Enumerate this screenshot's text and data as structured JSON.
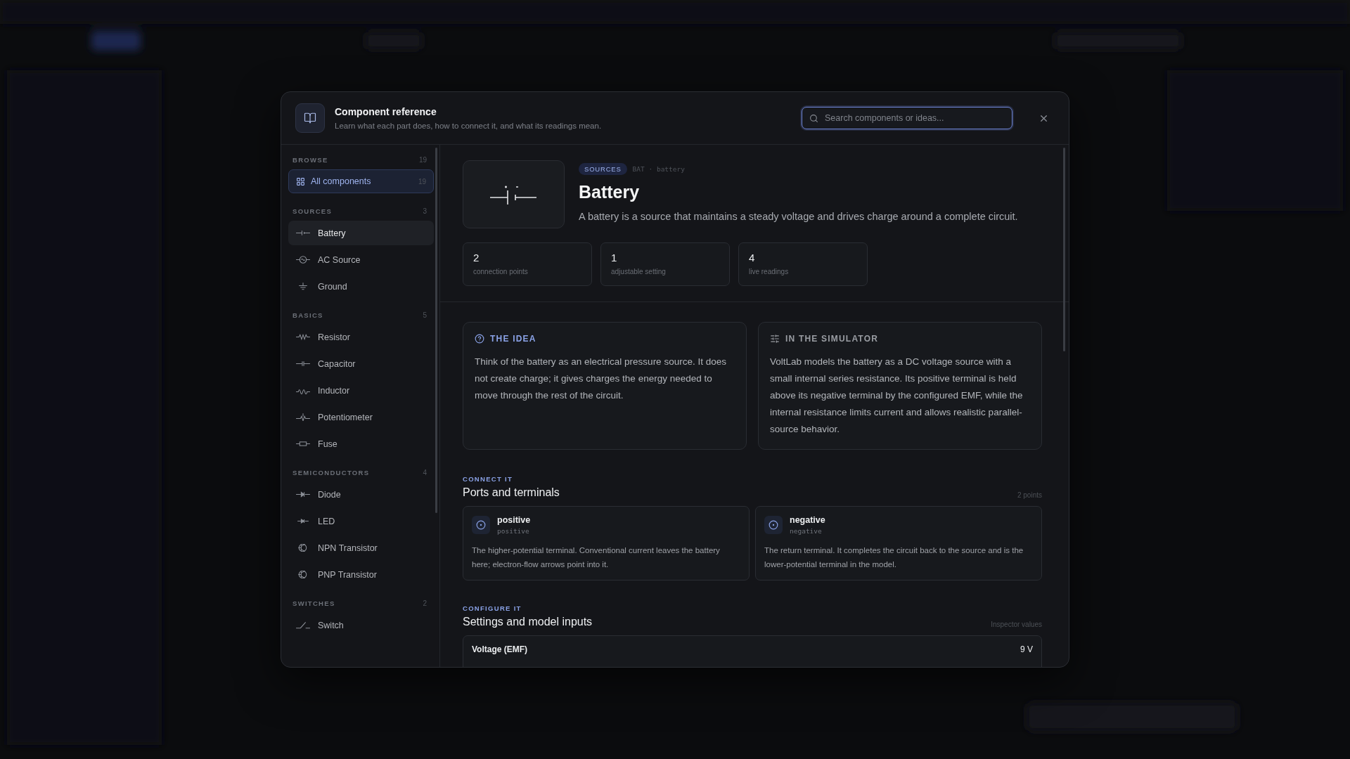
{
  "header": {
    "title": "Component reference",
    "subtitle": "Learn what each part does, how to connect it, and what its readings mean.",
    "search_placeholder": "Search components or ideas..."
  },
  "sidebar": {
    "browse": {
      "label": "BROWSE",
      "count": "19"
    },
    "all": {
      "label": "All components",
      "count": "19",
      "selected": true
    },
    "groups": [
      {
        "label": "SOURCES",
        "count": "3",
        "items": [
          {
            "label": "Battery",
            "selected": true
          },
          {
            "label": "AC Source",
            "selected": false
          },
          {
            "label": "Ground",
            "selected": false
          }
        ]
      },
      {
        "label": "BASICS",
        "count": "5",
        "items": [
          {
            "label": "Resistor",
            "selected": false
          },
          {
            "label": "Capacitor",
            "selected": false
          },
          {
            "label": "Inductor",
            "selected": false
          },
          {
            "label": "Potentiometer",
            "selected": false
          },
          {
            "label": "Fuse",
            "selected": false
          }
        ]
      },
      {
        "label": "SEMICONDUCTORS",
        "count": "4",
        "items": [
          {
            "label": "Diode",
            "selected": false
          },
          {
            "label": "LED",
            "selected": false
          },
          {
            "label": "NPN Transistor",
            "selected": false
          },
          {
            "label": "PNP Transistor",
            "selected": false
          }
        ]
      },
      {
        "label": "SWITCHES",
        "count": "2",
        "items": [
          {
            "label": "Switch",
            "selected": false
          }
        ]
      }
    ]
  },
  "detail": {
    "tag": "SOURCES",
    "meta": "BAT · battery",
    "title": "Battery",
    "description": "A battery is a source that maintains a steady voltage and drives charge around a complete circuit.",
    "stats": [
      {
        "value": "2",
        "label": "connection points"
      },
      {
        "value": "1",
        "label": "adjustable setting"
      },
      {
        "value": "4",
        "label": "live readings"
      }
    ],
    "notes": [
      {
        "kind": "idea",
        "heading": "THE IDEA",
        "text": "Think of the battery as an electrical pressure source. It does not create charge; it gives charges the energy needed to move through the rest of the circuit."
      },
      {
        "kind": "simulator",
        "heading": "IN THE SIMULATOR",
        "text": "VoltLab models the battery as a DC voltage source with a small internal series resistance. Its positive terminal is held above its negative terminal by the configured EMF, while the internal resistance limits current and allows realistic parallel-source behavior."
      }
    ],
    "connect": {
      "eyebrow": "CONNECT IT",
      "heading": "Ports and terminals",
      "note": "2 points",
      "ports": [
        {
          "name": "positive",
          "id": "positive",
          "text": "The higher-potential terminal. Conventional current leaves the battery here; electron-flow arrows point into it."
        },
        {
          "name": "negative",
          "id": "negative",
          "text": "The return terminal. It completes the circuit back to the source and is the lower-potential terminal in the model."
        }
      ]
    },
    "configure": {
      "eyebrow": "CONFIGURE IT",
      "heading": "Settings and model inputs",
      "note": "Inspector values",
      "settings": [
        {
          "name": "Voltage (EMF)",
          "value": "9 V"
        }
      ]
    }
  }
}
